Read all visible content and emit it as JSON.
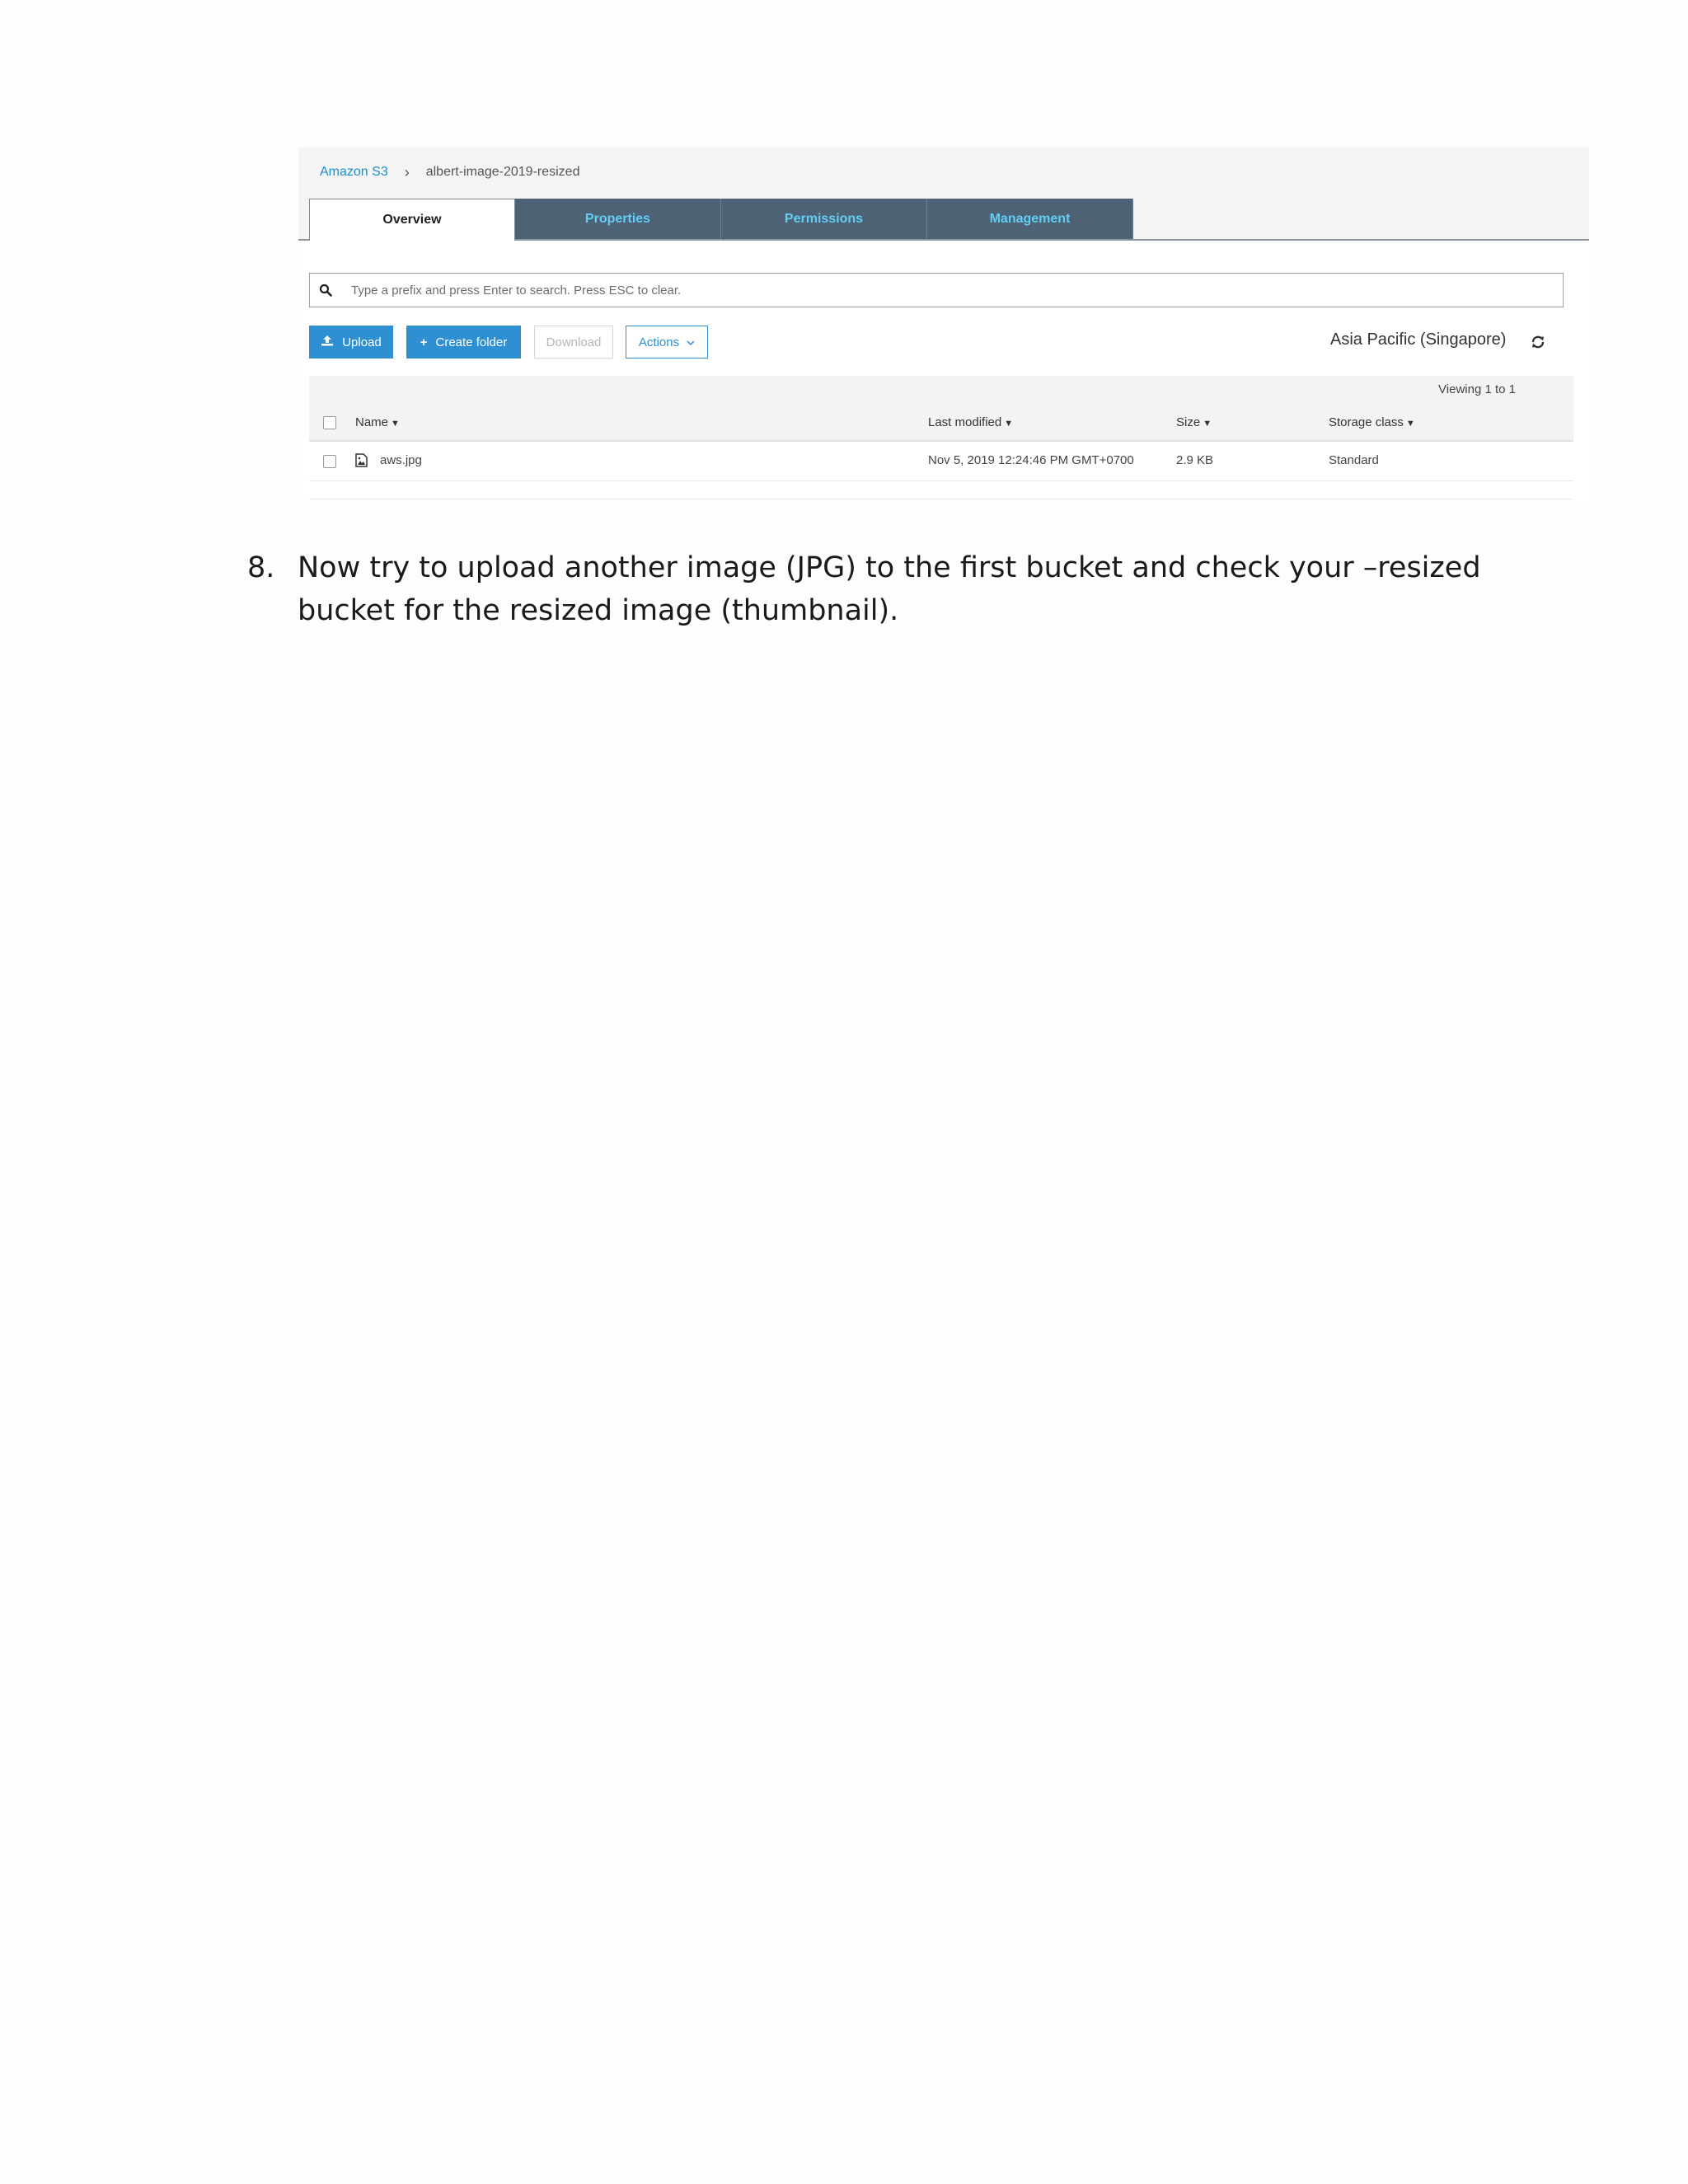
{
  "breadcrumb": {
    "root": "Amazon S3",
    "separator": "›",
    "current": "albert-image-2019-resized"
  },
  "tabs": [
    {
      "label": "Overview",
      "active": true
    },
    {
      "label": "Properties",
      "active": false
    },
    {
      "label": "Permissions",
      "active": false
    },
    {
      "label": "Management",
      "active": false
    }
  ],
  "search": {
    "placeholder": "Type a prefix and press Enter to search. Press ESC to clear.",
    "icon": "search-icon"
  },
  "toolbar": {
    "upload_label": "Upload",
    "create_folder_label": "Create folder",
    "download_label": "Download",
    "actions_label": "Actions",
    "region_label": "Asia Pacific (Singapore)",
    "refresh_icon": "refresh-icon"
  },
  "table": {
    "viewing": "Viewing 1 to 1",
    "headers": {
      "name": "Name",
      "last_modified": "Last modified",
      "size": "Size",
      "storage_class": "Storage class"
    },
    "rows": [
      {
        "name": "aws.jpg",
        "last_modified": "Nov 5, 2019 12:24:46 PM GMT+0700",
        "size": "2.9 KB",
        "storage_class": "Standard"
      }
    ]
  },
  "colors": {
    "primary": "#2f8fd3",
    "tab_inactive_bg": "#4d6375",
    "tab_inactive_text": "#62cdf5",
    "link": "#1a8fc9"
  },
  "document": {
    "step_number": "8.",
    "step_text": "Now try to upload another image (JPG) to the first bucket and check your –resized bucket for the resized image (thumbnail)."
  }
}
